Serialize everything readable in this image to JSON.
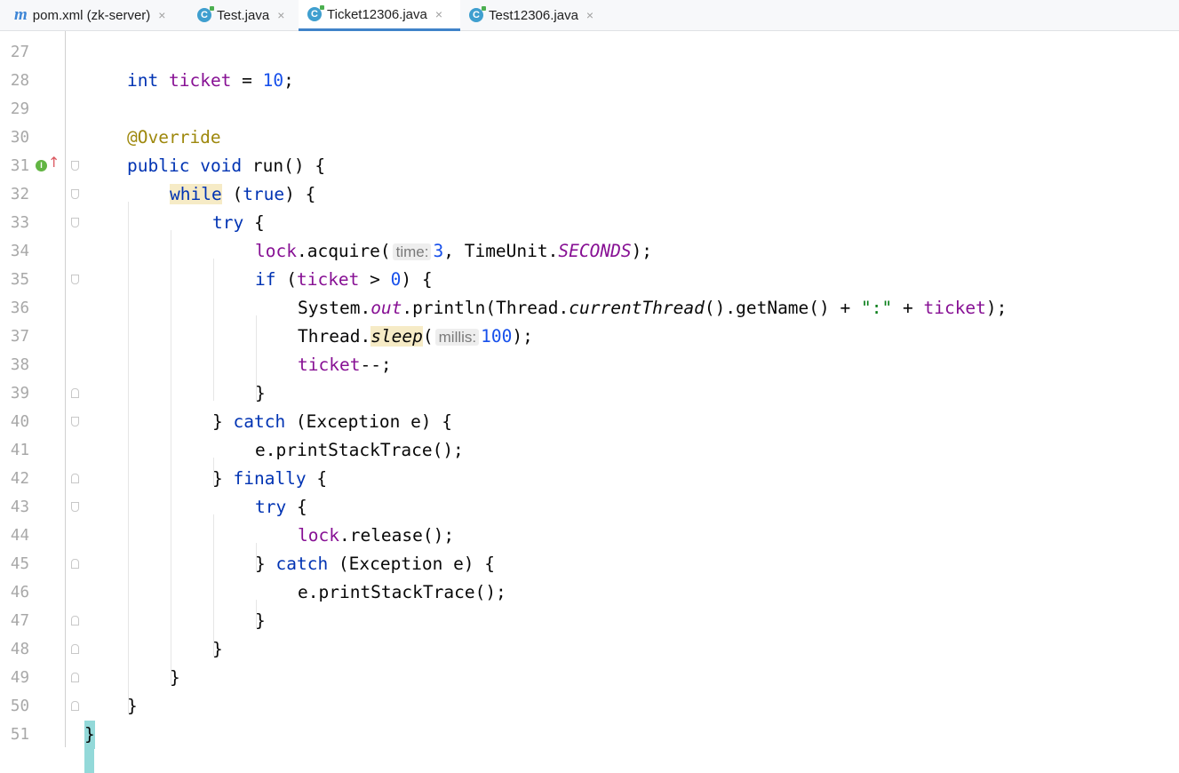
{
  "tabs": [
    {
      "label": "pom.xml (zk-server)",
      "icon": "maven-icon",
      "active": false
    },
    {
      "label": "Test.java",
      "icon": "java-class-icon",
      "active": false
    },
    {
      "label": "Ticket12306.java",
      "icon": "java-class-icon",
      "active": true
    },
    {
      "label": "Test12306.java",
      "icon": "java-class-icon",
      "active": false
    }
  ],
  "tab_close_glyph": "×",
  "maven_glyph": "m",
  "class_glyph": "C",
  "impl_glyph": "I",
  "editor": {
    "line_numbers": [
      "27",
      "28",
      "29",
      "30",
      "31",
      "32",
      "33",
      "34",
      "35",
      "36",
      "37",
      "38",
      "39",
      "40",
      "41",
      "42",
      "43",
      "44",
      "45",
      "46",
      "47",
      "48",
      "49",
      "50",
      "51"
    ],
    "code": {
      "l28_int": "int",
      "l28_ticket": "ticket",
      "l28_eq": " = ",
      "l28_num": "10",
      "l28_semi": ";",
      "l30_ann": "@Override",
      "l31_public": "public",
      "l31_void": "void",
      "l31_rest": " run() {",
      "l32_while": "while",
      "l32_open": " (",
      "l32_true": "true",
      "l32_close": ") {",
      "l33_try": "try",
      "l33_brace": " {",
      "l34_lock": "lock",
      "l34_call": ".acquire(",
      "l34_hint": "time:",
      "l34_num": "3",
      "l34_mid": ", TimeUnit.",
      "l34_const": "SECONDS",
      "l34_end": ");",
      "l35_if": "if",
      "l35_open": " (",
      "l35_ticket": "ticket",
      "l35_gt": " > ",
      "l35_num": "0",
      "l35_close": ") {",
      "l36_sys": "System.",
      "l36_out": "out",
      "l36_println": ".println(Thread.",
      "l36_ct": "currentThread",
      "l36_getname": "().getName() + ",
      "l36_str": "\":\"",
      "l36_plus": " + ",
      "l36_ticket": "ticket",
      "l36_end": ");",
      "l37_thread": "Thread.",
      "l37_sleep": "sleep",
      "l37_paren": "(",
      "l37_hint": "millis:",
      "l37_num": "100",
      "l37_end": ");",
      "l38_ticket": "ticket",
      "l38_end": "--;",
      "l39": "}",
      "l40_brace": "} ",
      "l40_catch": "catch",
      "l40_rest": " (Exception e) {",
      "l41": "e.printStackTrace();",
      "l42_brace": "} ",
      "l42_finally": "finally",
      "l42_rest": " {",
      "l43_try": "try",
      "l43_brace": " {",
      "l44_lock": "lock",
      "l44_rest": ".release();",
      "l45_brace": "} ",
      "l45_catch": "catch",
      "l45_rest": " (Exception e) {",
      "l46": "e.printStackTrace();",
      "l47": "}",
      "l48": "}",
      "l49": "}",
      "l50": "}",
      "l51": "}"
    }
  },
  "colors": {
    "keyword": "#0033b3",
    "field": "#871094",
    "number": "#1750eb",
    "annotation": "#9e880d",
    "string": "#067d17",
    "active_tab_underline": "#4083c9",
    "brace_highlight": "#93d9d9"
  }
}
